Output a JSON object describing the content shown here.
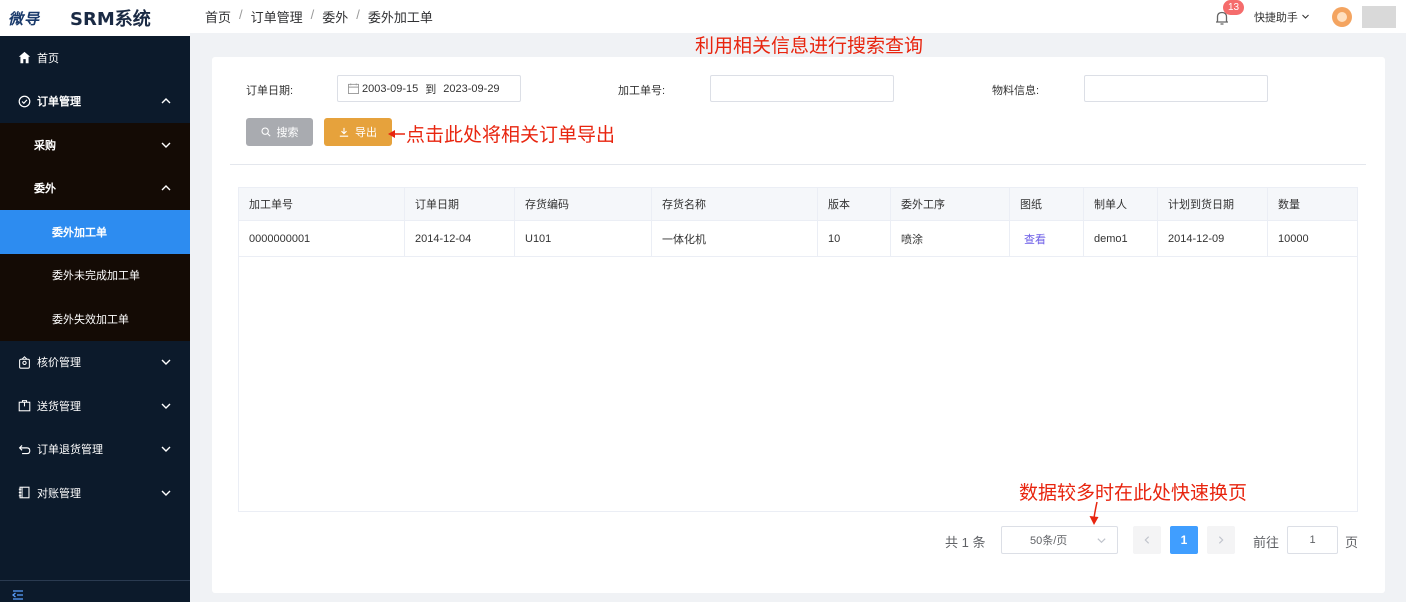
{
  "brand": {
    "logo": "微导",
    "system": "SRM系统"
  },
  "sidebar": {
    "items": [
      {
        "label": "首页",
        "icon": "home-icon"
      },
      {
        "label": "订单管理",
        "icon": "check-circle-icon",
        "expanded": true
      },
      {
        "label": "采购"
      },
      {
        "label": "委外",
        "expanded": true
      },
      {
        "label": "委外加工单",
        "active": true
      },
      {
        "label": "委外未完成加工单"
      },
      {
        "label": "委外失效加工单"
      },
      {
        "label": "核价管理",
        "icon": "price-tag-icon"
      },
      {
        "label": "送货管理",
        "icon": "package-icon"
      },
      {
        "label": "订单退货管理",
        "icon": "return-icon"
      },
      {
        "label": "对账管理",
        "icon": "ledger-icon"
      }
    ]
  },
  "header": {
    "breadcrumb": [
      "首页",
      "订单管理",
      "委外",
      "委外加工单"
    ],
    "notification_count": "13",
    "quick_helper": "快捷助手"
  },
  "annotations": {
    "search_hint": "利用相关信息进行搜索查询",
    "export_hint": "点击此处将相关订单导出",
    "pager_hint": "数据较多时在此处快速换页"
  },
  "filters": {
    "order_date_label": "订单日期:",
    "date_start": "2003-09-15",
    "date_sep": "到",
    "date_end": "2023-09-29",
    "process_no_label": "加工单号:",
    "process_no_value": "",
    "material_label": "物料信息:",
    "material_value": ""
  },
  "buttons": {
    "search": "搜索",
    "export": "导出"
  },
  "colors": {
    "sidebar_bg": "#0c1a2b",
    "submenu_bg": "#140b05",
    "active": "#2d8cf0",
    "search_btn": "#a9abb0",
    "export_btn": "#e6a23c",
    "annotation": "#e8250f",
    "link": "#6b5ce7"
  },
  "table": {
    "columns": [
      "加工单号",
      "订单日期",
      "存货编码",
      "存货名称",
      "版本",
      "委外工序",
      "图纸",
      "制单人",
      "计划到货日期",
      "数量"
    ],
    "rows": [
      [
        "0000000001",
        "2014-12-04",
        "U101",
        "一体化机",
        "10",
        "喷涂",
        "查看",
        "demo1",
        "2014-12-09",
        "10000"
      ]
    ]
  },
  "pagination": {
    "total": "共 1 条",
    "page_size": "50条/页",
    "current_page": "1",
    "goto_label": "前往",
    "goto_value": "1",
    "page_unit": "页"
  }
}
